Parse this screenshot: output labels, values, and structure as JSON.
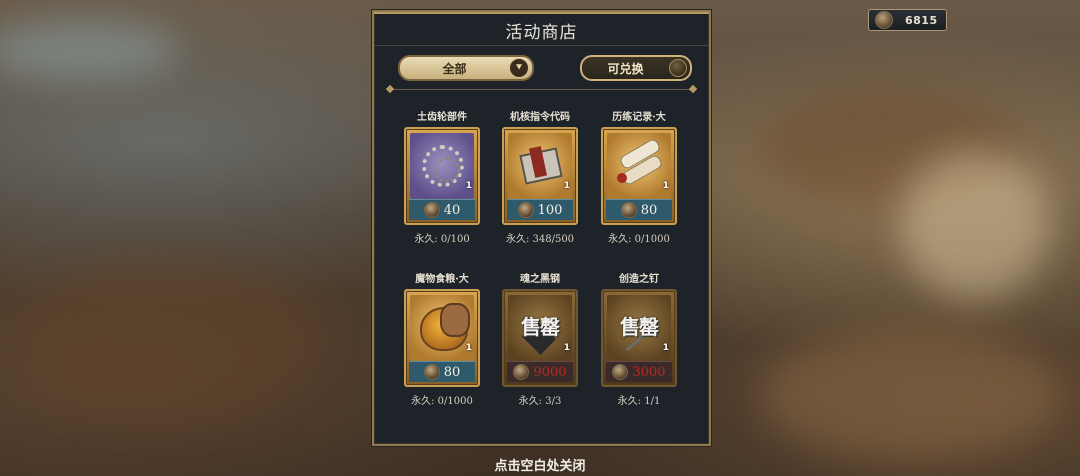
{
  "currency": {
    "icon": "coin-icon",
    "amount": "6815"
  },
  "shop": {
    "title": "活动商店",
    "filter_label": "全部",
    "toggle_label": "可兑换"
  },
  "items": [
    {
      "name": "土齿轮部件",
      "qty": "1",
      "price": "40",
      "limit": "永久: 0/100",
      "sold_out": false
    },
    {
      "name": "机核指令代码",
      "qty": "1",
      "price": "100",
      "limit": "永久: 348/500",
      "sold_out": false
    },
    {
      "name": "历练记录·大",
      "qty": "1",
      "price": "80",
      "limit": "永久: 0/1000",
      "sold_out": false
    },
    {
      "name": "魔物食粮·大",
      "qty": "1",
      "price": "80",
      "limit": "永久: 0/1000",
      "sold_out": false
    },
    {
      "name": "魂之黑钢",
      "qty": "1",
      "price": "9000",
      "limit": "永久: 3/3",
      "sold_out": true,
      "stamp": "售罄"
    },
    {
      "name": "创造之钉",
      "qty": "1",
      "price": "3000",
      "limit": "永久: 1/1",
      "sold_out": true,
      "stamp": "售罄"
    }
  ],
  "footer": {
    "close_hint": "点击空白处关闭"
  }
}
